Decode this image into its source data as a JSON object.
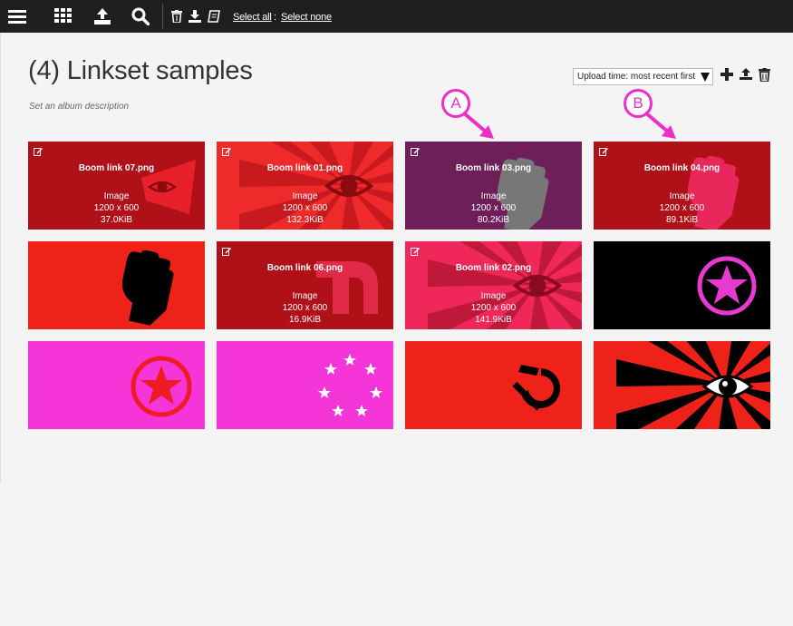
{
  "toolbar": {
    "select_all": "Select all",
    "separator": ":",
    "select_none": "Select none",
    "icons": [
      "menu-icon",
      "grid-icon",
      "upload-icon",
      "search-icon",
      "trash-icon",
      "download-icon",
      "book-icon"
    ]
  },
  "album": {
    "title": "(4) Linkset samples",
    "description": "Set an album description",
    "sort_value": "Upload time: most recent first"
  },
  "tiles": [
    {
      "filename": "Boom link 07.png",
      "type": "Image",
      "dimensions": "1200 x 600",
      "size": "37.0KiB"
    },
    {
      "filename": "Boom link 01.png",
      "type": "Image",
      "dimensions": "1200 x 600",
      "size": "132.3KiB"
    },
    {
      "filename": "Boom link 03.png",
      "type": "Image",
      "dimensions": "1200 x 600",
      "size": "80.2KiB"
    },
    {
      "filename": "Boom link 04.png",
      "type": "Image",
      "dimensions": "1200 x 600",
      "size": "89.1KiB"
    },
    {
      "filename": "",
      "type": "",
      "dimensions": "",
      "size": ""
    },
    {
      "filename": "Boom link 06.png",
      "type": "Image",
      "dimensions": "1200 x 600",
      "size": "16.9KiB"
    },
    {
      "filename": "Boom link 02.png",
      "type": "Image",
      "dimensions": "1200 x 600",
      "size": "141.9KiB"
    },
    {
      "filename": "",
      "type": "",
      "dimensions": "",
      "size": ""
    },
    {
      "filename": "",
      "type": "",
      "dimensions": "",
      "size": ""
    },
    {
      "filename": "",
      "type": "",
      "dimensions": "",
      "size": ""
    },
    {
      "filename": "",
      "type": "",
      "dimensions": "",
      "size": ""
    },
    {
      "filename": "",
      "type": "",
      "dimensions": "",
      "size": ""
    }
  ],
  "callouts": {
    "a": "A",
    "b": "B"
  },
  "colors": {
    "accent_pink": "#ee2ec9",
    "toolbar_bg": "#1f1f1f"
  }
}
